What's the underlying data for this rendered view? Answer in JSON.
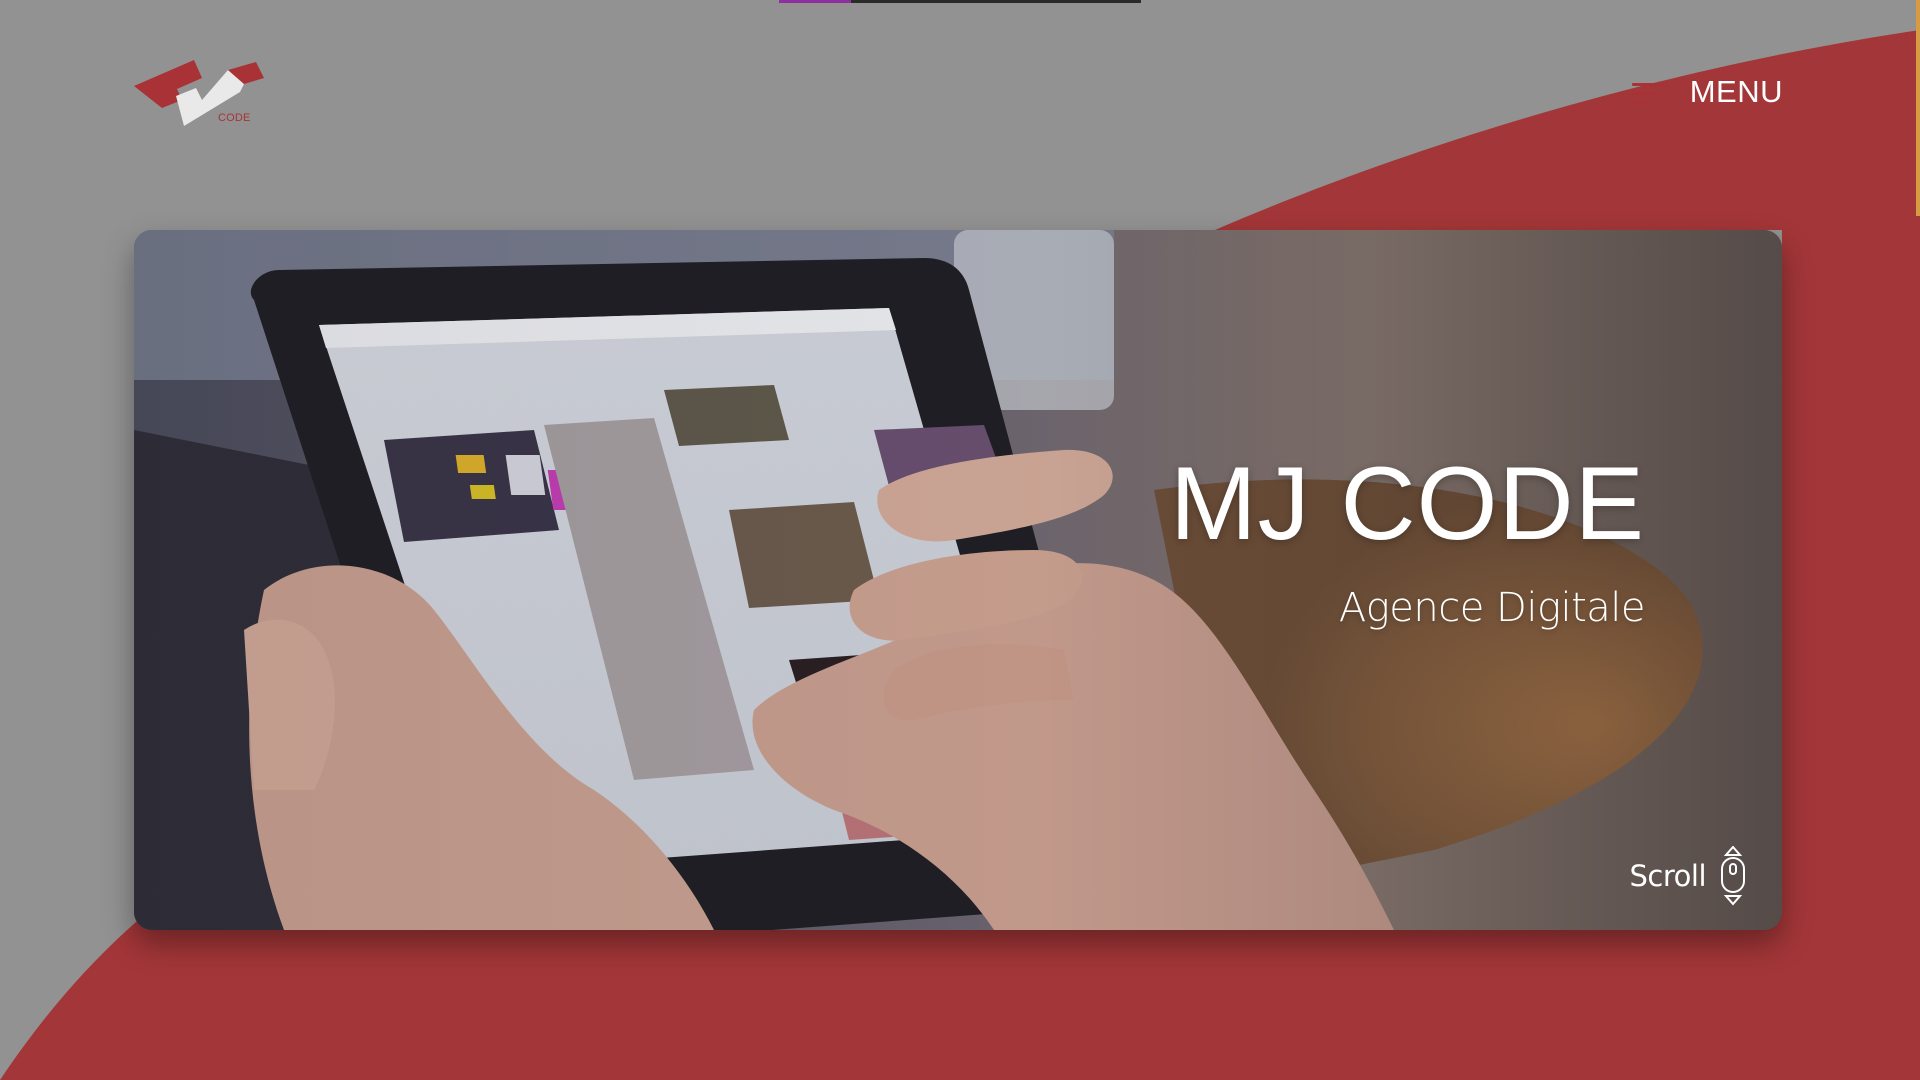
{
  "brand": {
    "logo_text": "CODE",
    "accent_color": "#a83235",
    "background_color": "#929292"
  },
  "loader": {
    "progress": 0.2
  },
  "header": {
    "menu_label": "MENU",
    "menu_icon": "hamburger-lines-icon"
  },
  "hero": {
    "title": "MJ CODE",
    "subtitle": "Agence Digitale",
    "image": "tablet-shopping-photo",
    "scroll_label": "Scroll",
    "scroll_icon": "mouse-scroll-icon"
  }
}
